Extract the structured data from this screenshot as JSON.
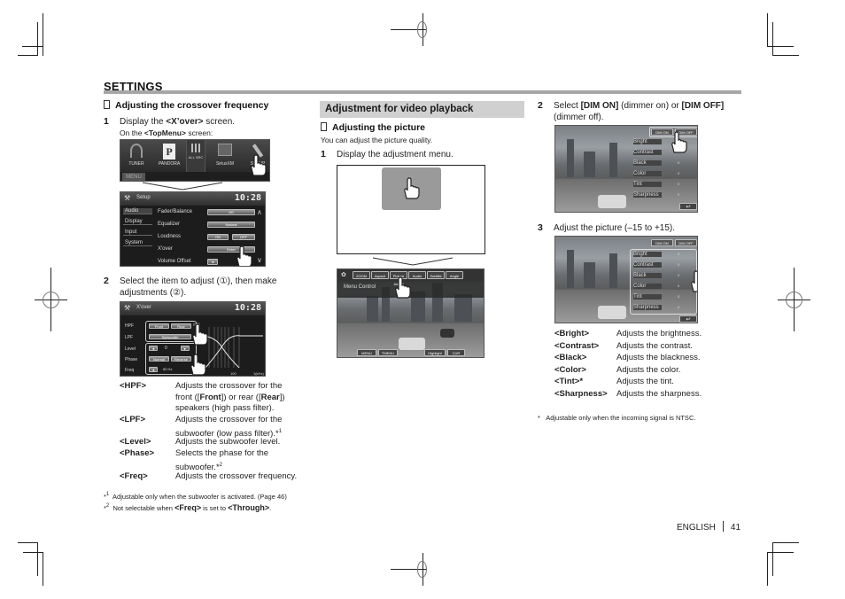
{
  "page": {
    "section_title": "SETTINGS",
    "footer": {
      "language": "ENGLISH",
      "page_number": "41"
    }
  },
  "crossover": {
    "heading": "Adjusting the crossover frequency",
    "step1": {
      "number": "1",
      "text_pre": "Display the ",
      "text_bold": "<X’over>",
      "text_post": " screen.",
      "sub_pre": "On the ",
      "sub_bold": "<TopMenu>",
      "sub_post": "  screen:"
    },
    "topmenu_screen": {
      "items": [
        "TUNER",
        "PANDORA",
        "ALL SRC",
        "SiriusXM",
        "SETUP"
      ],
      "menu_label": "MENU"
    },
    "setup_screen": {
      "title": "Setup",
      "clock": "10:28",
      "side_items": [
        "Audio",
        "Display",
        "Input",
        "System"
      ],
      "rows": [
        {
          "label": "Fader/Balance",
          "value": "0/0"
        },
        {
          "label": "Equalizer",
          "value": "Natural"
        },
        {
          "label": "Loudness",
          "value": "ON",
          "value2": "OFF"
        },
        {
          "label": "X'over",
          "value": "Enter"
        },
        {
          "label": "Volume Offset",
          "value": "0"
        }
      ]
    },
    "step2": {
      "number": "2",
      "text": "Select the item to adjust (①), then make adjustments (②)."
    },
    "xover_screen": {
      "title": "X'over",
      "clock": "10:28",
      "rows": [
        {
          "label": "HPF",
          "buttons": [
            "Front",
            "Rear"
          ]
        },
        {
          "label": "LPF",
          "buttons": [
            "Subwoofer"
          ]
        },
        {
          "label": "Level",
          "buttons": [
            "◄",
            "0",
            "►"
          ]
        },
        {
          "label": "Phase",
          "buttons": [
            "Normal",
            "Reverse"
          ]
        },
        {
          "label": "Freq",
          "buttons": [
            "◄",
            "80 Hz",
            "►"
          ]
        }
      ],
      "graph_labels": [
        "(dB)",
        "100",
        "1(kHz)"
      ],
      "callouts": [
        "①",
        "②"
      ]
    },
    "definitions": [
      {
        "term": "<HPF>",
        "desc_lines": [
          "Adjusts the crossover for the",
          "front ([Front]) or rear ([Rear])",
          "speakers (high pass filter)."
        ]
      },
      {
        "term": "<LPF>",
        "desc_lines": [
          "Adjusts the crossover for the",
          "subwoofer (low pass filter).*¹"
        ]
      },
      {
        "term": "<Level>",
        "desc_lines": [
          "Adjusts the subwoofer level."
        ]
      },
      {
        "term": "<Phase>",
        "desc_lines": [
          "Selects the phase for the",
          "subwoofer.*²"
        ]
      },
      {
        "term": "<Freq>",
        "desc_lines": [
          "Adjusts the crossover frequency."
        ]
      }
    ],
    "footnotes": [
      {
        "mark": "*¹",
        "text": "Adjustable only when the subwoofer is activated. (Page 46)"
      },
      {
        "mark": "*²",
        "text_pre": "Not selectable when ",
        "bold1": "<Freq>",
        "text_mid": " is set to ",
        "bold2": "<Through>",
        "text_post": "."
      }
    ]
  },
  "video": {
    "section_heading": "Adjustment for video playback",
    "heading": "Adjusting the picture",
    "intro": "You can adjust the picture quality.",
    "step1": {
      "number": "1",
      "text": "Display the adjustment menu."
    },
    "menu_screen": {
      "tabs": [
        "ZOOM",
        "Aspect",
        "Picture Adjust",
        "Audio",
        "Subtitle",
        "Angle"
      ],
      "title": "Menu Control",
      "bottom_buttons": [
        "MENU",
        "TMENU",
        "Highlight",
        "CUR"
      ]
    },
    "step2": {
      "number": "2",
      "text_pre": "Select ",
      "bold1": "[DIM ON]",
      "text_mid": " (dimmer on) or ",
      "bold2": "[DIM OFF]",
      "text_post": " (dimmer off)."
    },
    "step3": {
      "number": "3",
      "text": "Adjust the picture (–15 to +15)."
    },
    "picture_screen": {
      "dim_buttons": [
        "DIM ON",
        "DIM OFF"
      ],
      "rows": [
        {
          "label": "Bright",
          "value": "0"
        },
        {
          "label": "Contrast",
          "value": "0"
        },
        {
          "label": "Black",
          "value": "0"
        },
        {
          "label": "Color",
          "value": "0"
        },
        {
          "label": "Tint",
          "value": "0"
        },
        {
          "label": "Sharpness",
          "value": "0"
        }
      ],
      "back_icon": "return-arrow-icon"
    },
    "definitions": [
      {
        "term": "<Bright>",
        "desc": "Adjusts the brightness."
      },
      {
        "term": "<Contrast>",
        "desc": "Adjusts the contrast."
      },
      {
        "term": "<Black>",
        "desc": "Adjusts the blackness."
      },
      {
        "term": "<Color>",
        "desc": "Adjusts the color."
      },
      {
        "term": "<Tint>*",
        "desc": "Adjusts the tint."
      },
      {
        "term": "<Sharpness>",
        "desc": "Adjusts the sharpness."
      }
    ],
    "footnote": {
      "mark": "*",
      "text": "Adjustable only when the incoming signal is NTSC."
    }
  }
}
